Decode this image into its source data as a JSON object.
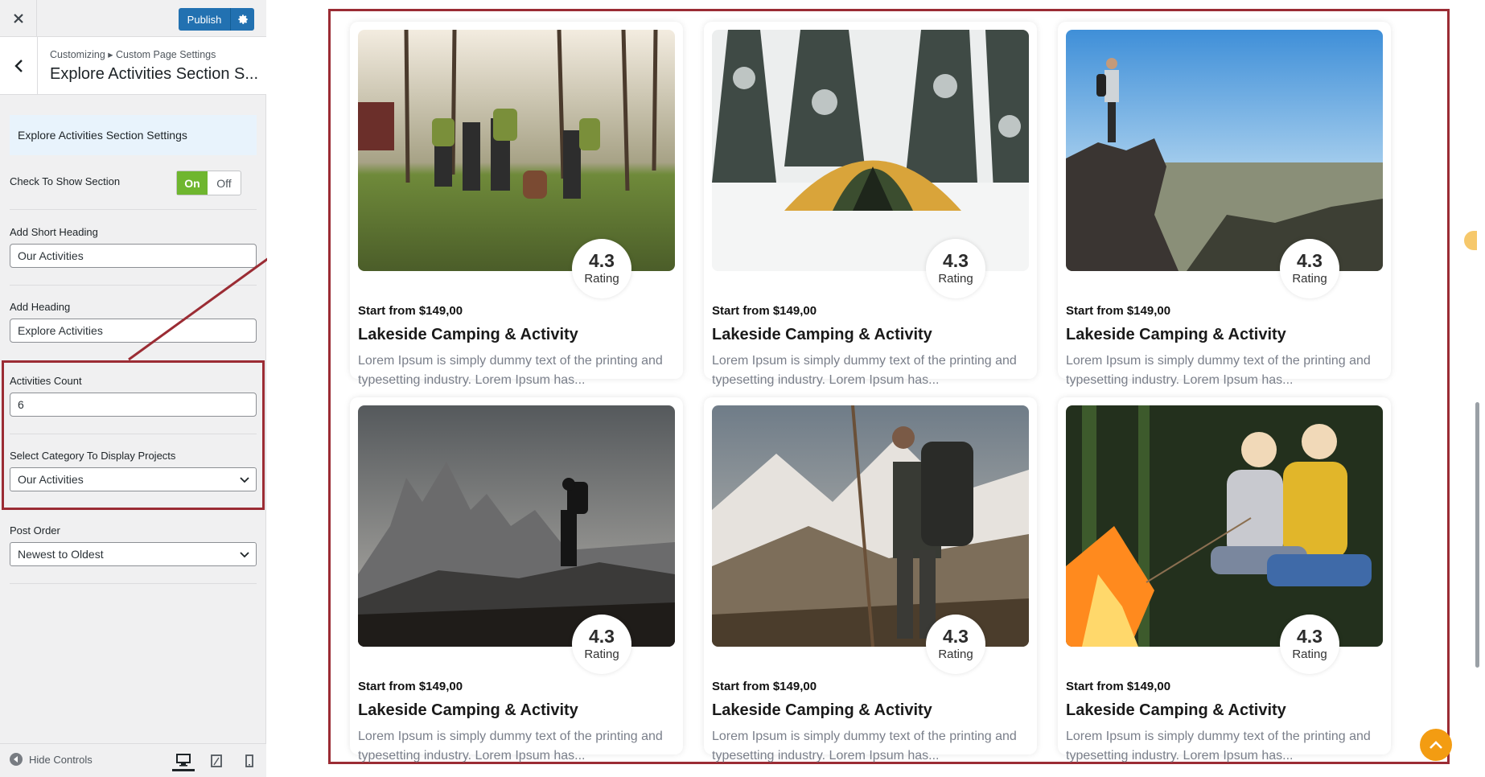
{
  "topbar": {
    "close_icon": "close-icon",
    "publish_label": "Publish",
    "publish_settings_icon": "gear-icon"
  },
  "header": {
    "breadcrumb": "Customizing ▸ Custom Page Settings",
    "title": "Explore Activities Section S..."
  },
  "section": {
    "description": "Explore Activities Section Settings",
    "show_section": {
      "label": "Check To Show Section",
      "on_label": "On",
      "off_label": "Off",
      "value": "On"
    },
    "short_heading": {
      "label": "Add Short Heading",
      "value": "Our Activities"
    },
    "heading": {
      "label": "Add Heading",
      "value": "Explore Activities"
    },
    "activities_count": {
      "label": "Activities Count",
      "value": "6"
    },
    "category": {
      "label": "Select Category To Display Projects",
      "value": "Our Activities"
    },
    "post_order": {
      "label": "Post Order",
      "value": "Newest to Oldest"
    }
  },
  "footer": {
    "hide_controls_label": "Hide Controls",
    "devices": [
      "desktop-icon",
      "tablet-icon",
      "mobile-icon"
    ]
  },
  "cards": [
    {
      "price": "Start from $149,00",
      "title": "Lakeside Camping & Activity",
      "rating": "4.3",
      "rating_label": "Rating",
      "desc": "Lorem Ipsum is simply dummy text of the printing and typesetting industry. Lorem Ipsum has...",
      "image": "hikers-in-forest"
    },
    {
      "price": "Start from $149,00",
      "title": "Lakeside Camping & Activity",
      "rating": "4.3",
      "rating_label": "Rating",
      "desc": "Lorem Ipsum is simply dummy text of the printing and typesetting industry. Lorem Ipsum has...",
      "image": "tent-in-snow"
    },
    {
      "price": "Start from $149,00",
      "title": "Lakeside Camping & Activity",
      "rating": "4.3",
      "rating_label": "Rating",
      "desc": "Lorem Ipsum is simply dummy text of the printing and typesetting industry. Lorem Ipsum has...",
      "image": "hiker-on-rock"
    },
    {
      "price": "Start from $149,00",
      "title": "Lakeside Camping & Activity",
      "rating": "4.3",
      "rating_label": "Rating",
      "desc": "Lorem Ipsum is simply dummy text of the printing and typesetting industry. Lorem Ipsum has...",
      "image": "mountain-silhouette"
    },
    {
      "price": "Start from $149,00",
      "title": "Lakeside Camping & Activity",
      "rating": "4.3",
      "rating_label": "Rating",
      "desc": "Lorem Ipsum is simply dummy text of the printing and typesetting industry. Lorem Ipsum has...",
      "image": "backpacker-mountains"
    },
    {
      "price": "Start from $149,00",
      "title": "Lakeside Camping & Activity",
      "rating": "4.3",
      "rating_label": "Rating",
      "desc": "Lorem Ipsum is simply dummy text of the printing and typesetting industry. Lorem Ipsum has...",
      "image": "campfire-friends"
    }
  ],
  "colors": {
    "accent": "#2271b1",
    "toggle_on": "#6fb62f",
    "highlight": "#9b2c34",
    "scroll_top": "#f39c12"
  }
}
